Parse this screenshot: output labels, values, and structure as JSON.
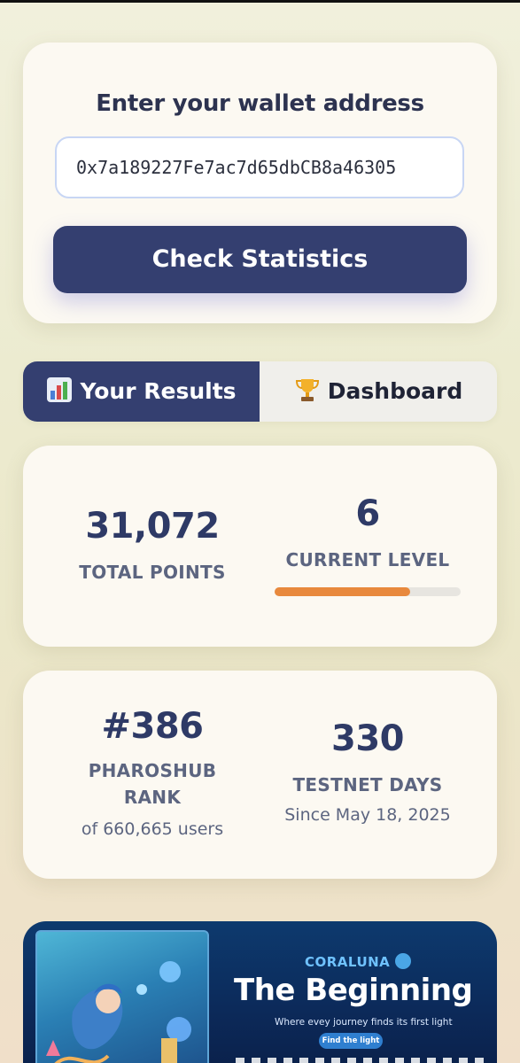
{
  "wallet": {
    "title": "Enter your wallet address",
    "input_value": "0x7a189227Fe7ac7d65dbCB8a46305",
    "check_button": "Check Statistics"
  },
  "tabs": [
    {
      "icon": "bar-chart-icon",
      "label": "Your Results",
      "active": true
    },
    {
      "icon": "trophy-icon",
      "label": "Dashboard",
      "active": false
    }
  ],
  "stats": {
    "total_points": {
      "value": "31,072",
      "label": "TOTAL POINTS"
    },
    "current_level": {
      "value": "6",
      "label": "CURRENT LEVEL",
      "progress": 0.73
    },
    "rank": {
      "value": "#386",
      "label_line1": "PHAROSHUB",
      "label_line2": "RANK",
      "sub": "of 660,665 users"
    },
    "testnet_days": {
      "value": "330",
      "label": "TESTNET DAYS",
      "sub": "Since May 18, 2025"
    }
  },
  "banner": {
    "brand": "CORALUNA",
    "title": "The Beginning",
    "tagline": "Where evey journey finds its first  light",
    "button": "Find the light"
  },
  "colors": {
    "primary": "#343f70",
    "progress": "#e8893d",
    "card_bg": "#fcf9f2"
  }
}
